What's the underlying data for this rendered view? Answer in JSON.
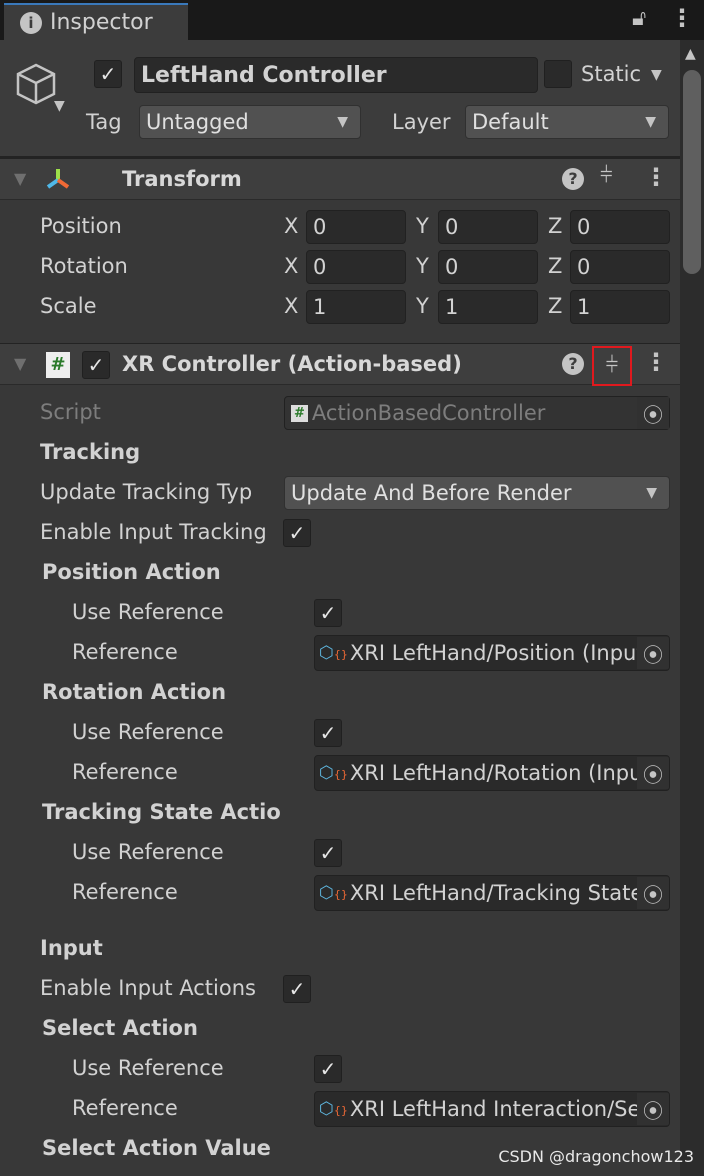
{
  "tab": {
    "title": "Inspector"
  },
  "gameobject": {
    "active": true,
    "name": "LeftHand Controller",
    "static_label": "Static",
    "static": false,
    "tag_label": "Tag",
    "tag": "Untagged",
    "layer_label": "Layer",
    "layer": "Default"
  },
  "transform": {
    "title": "Transform",
    "rows": [
      {
        "label": "Position",
        "x": "0",
        "y": "0",
        "z": "0"
      },
      {
        "label": "Rotation",
        "x": "0",
        "y": "0",
        "z": "0"
      },
      {
        "label": "Scale",
        "x": "1",
        "y": "1",
        "z": "1"
      }
    ],
    "axes": [
      "X",
      "Y",
      "Z"
    ]
  },
  "xr": {
    "title": "XR Controller (Action-based)",
    "enabled": true,
    "script_label": "Script",
    "script": "ActionBasedController",
    "fields": [
      {
        "type": "header",
        "label": "Tracking"
      },
      {
        "type": "dropdown",
        "label": "Update Tracking Typ",
        "value": "Update And Before Render"
      },
      {
        "type": "check",
        "label": "Enable Input Tracking",
        "checked": true
      },
      {
        "type": "subheader",
        "label": "Position Action"
      },
      {
        "type": "check",
        "indent": true,
        "label": "Use Reference",
        "checked": true
      },
      {
        "type": "ref",
        "indent": true,
        "label": "Reference",
        "value": "XRI LeftHand/Position (Input Action Reference)"
      },
      {
        "type": "subheader",
        "label": "Rotation Action"
      },
      {
        "type": "check",
        "indent": true,
        "label": "Use Reference",
        "checked": true
      },
      {
        "type": "ref",
        "indent": true,
        "label": "Reference",
        "value": "XRI LeftHand/Rotation (Input Action Reference)"
      },
      {
        "type": "subheader",
        "label": "Tracking State Action"
      },
      {
        "type": "check",
        "indent": true,
        "label": "Use Reference",
        "checked": true
      },
      {
        "type": "ref",
        "indent": true,
        "label": "Reference",
        "value": "XRI LeftHand/Tracking State (Input Action Reference)"
      },
      {
        "type": "gap"
      },
      {
        "type": "header",
        "label": "Input"
      },
      {
        "type": "check",
        "label": "Enable Input Actions",
        "checked": true
      },
      {
        "type": "subheader",
        "label": "Select Action"
      },
      {
        "type": "check",
        "indent": true,
        "label": "Use Reference",
        "checked": true
      },
      {
        "type": "ref",
        "indent": true,
        "label": "Reference",
        "value": "XRI LeftHand Interaction/Select (Input Action Reference)"
      },
      {
        "type": "subheader",
        "label": "Select Action Value"
      }
    ]
  },
  "watermark": "CSDN @dragonchow123",
  "colors": {
    "highlight": "#e0191e",
    "accent": "#3a79bb"
  }
}
